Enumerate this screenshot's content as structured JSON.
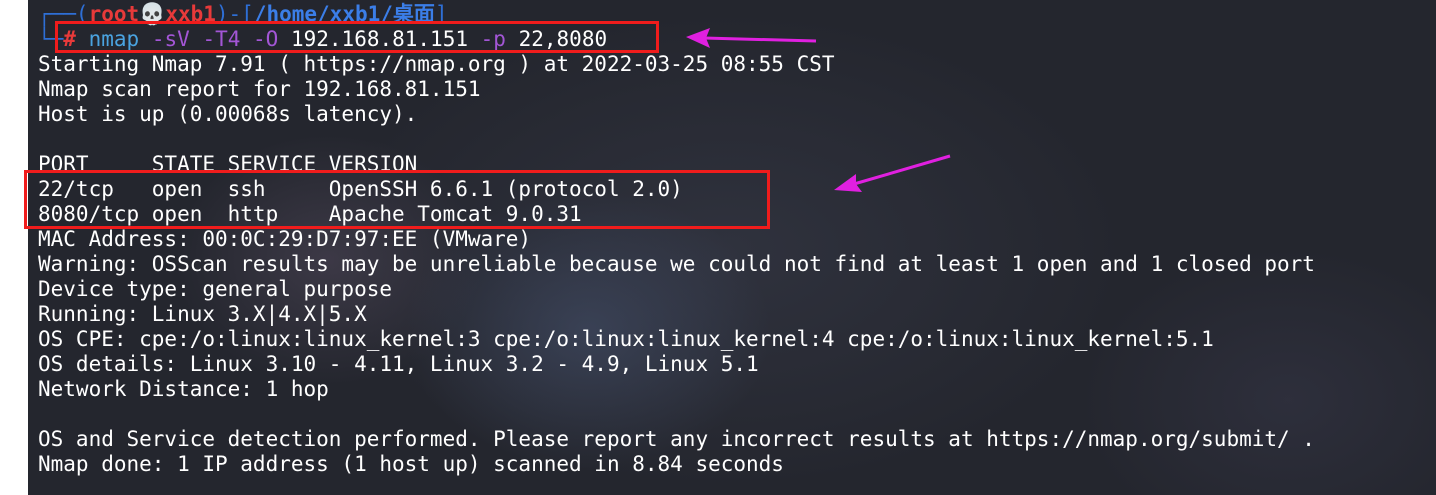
{
  "prompt": {
    "open_bracket": "┌──(",
    "user": "root",
    "skull": "💀",
    "host": "xxb1",
    "separator": ")-[",
    "path": "/home/xxb1/桌面",
    "close_bracket": "]",
    "branch": "└─",
    "hash": "#"
  },
  "command": {
    "name": "nmap",
    "flag_sv": "-sV",
    "flag_t4": "-T4",
    "flag_o": "-O",
    "target": "192.168.81.151",
    "flag_p": "-p",
    "ports": "22,8080"
  },
  "output": {
    "lines": [
      "Starting Nmap 7.91 ( https://nmap.org ) at 2022-03-25 08:55 CST",
      "Nmap scan report for 192.168.81.151",
      "Host is up (0.00068s latency).",
      "",
      "PORT     STATE SERVICE VERSION",
      "22/tcp   open  ssh     OpenSSH 6.6.1 (protocol 2.0)",
      "8080/tcp open  http    Apache Tomcat 9.0.31",
      "MAC Address: 00:0C:29:D7:97:EE (VMware)",
      "Warning: OSScan results may be unreliable because we could not find at least 1 open and 1 closed port",
      "Device type: general purpose",
      "Running: Linux 3.X|4.X|5.X",
      "OS CPE: cpe:/o:linux:linux_kernel:3 cpe:/o:linux:linux_kernel:4 cpe:/o:linux:linux_kernel:5.1",
      "OS details: Linux 3.10 - 4.11, Linux 3.2 - 4.9, Linux 5.1",
      "Network Distance: 1 hop",
      "",
      "OS and Service detection performed. Please report any incorrect results at https://nmap.org/submit/ .",
      "Nmap done: 1 IP address (1 host up) scanned in 8.84 seconds"
    ]
  },
  "colors": {
    "highlight_box": "#f01c1c",
    "arrow": "#e020e0",
    "background": "#24262e"
  }
}
